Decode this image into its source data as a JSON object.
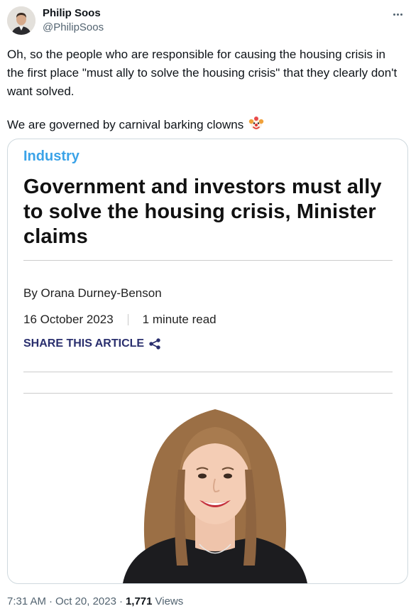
{
  "author": {
    "display_name": "Philip Soos",
    "handle": "@PhilipSoos"
  },
  "tweet": {
    "paragraph_1": "Oh, so the people who are responsible for causing the housing crisis in the first place \"must ally to solve the housing crisis\" that they clearly don't want solved.",
    "paragraph_2": "We are governed by carnival barking clowns"
  },
  "card": {
    "category": "Industry",
    "headline": "Government and investors must ally to solve the housing crisis, Minister claims",
    "byline": "By Orana Durney-Benson",
    "date": "16 October 2023",
    "read_time": "1 minute read",
    "share_label": "SHARE THIS ARTICLE"
  },
  "footer": {
    "time": "7:31 AM",
    "date": "Oct 20, 2023",
    "views_count": "1,771",
    "views_label": "Views"
  },
  "icons": {
    "more": "more-dots-icon",
    "clown": "clown-face-emoji",
    "share": "share-icon"
  },
  "colors": {
    "category": "#3ba3e8",
    "share": "#2a2f6e",
    "secondary_text": "#536471"
  }
}
